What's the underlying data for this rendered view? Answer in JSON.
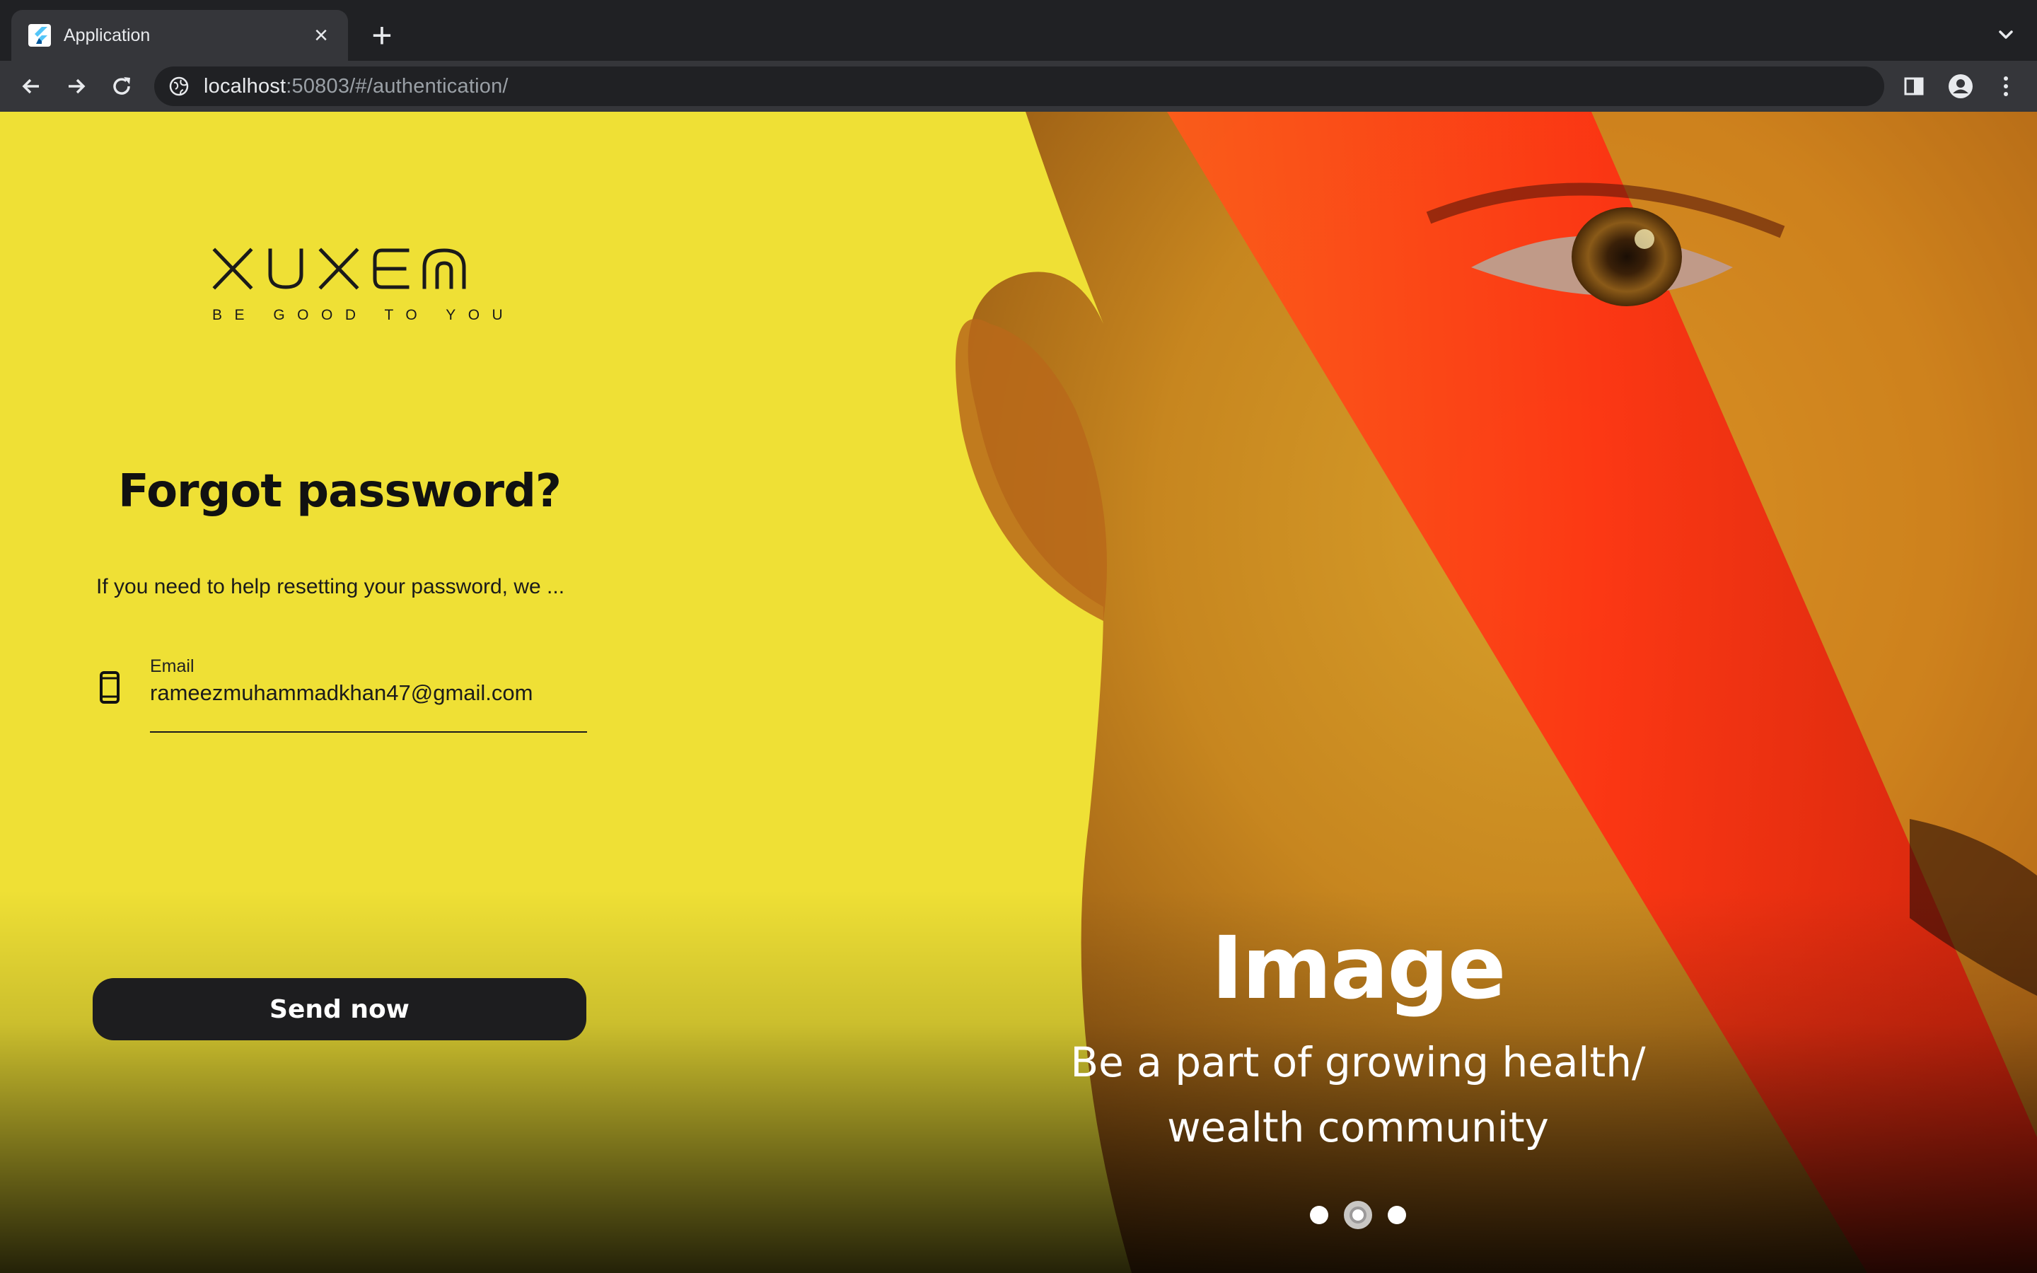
{
  "browser": {
    "tab_title": "Application",
    "url_host": "localhost",
    "url_rest": ":50803/#/authentication/"
  },
  "brand": {
    "logo_text": "XUXEM",
    "tagline": "BE GOOD TO YOU"
  },
  "form": {
    "title": "Forgot password?",
    "subtitle": "If you need to help resetting your password, we ...",
    "email_label": "Email",
    "email_value": "rameezmuhammadkhan47@gmail.com",
    "submit_label": "Send now"
  },
  "carousel": {
    "title": "Image",
    "caption_line1": "Be a part of growing health/",
    "caption_line2": "wealth community",
    "active_index": 1,
    "count": 3
  },
  "colors": {
    "background_yellow": "#efe035",
    "button_dark": "#1d1d1f",
    "accent_red": "#ff3a1a"
  }
}
